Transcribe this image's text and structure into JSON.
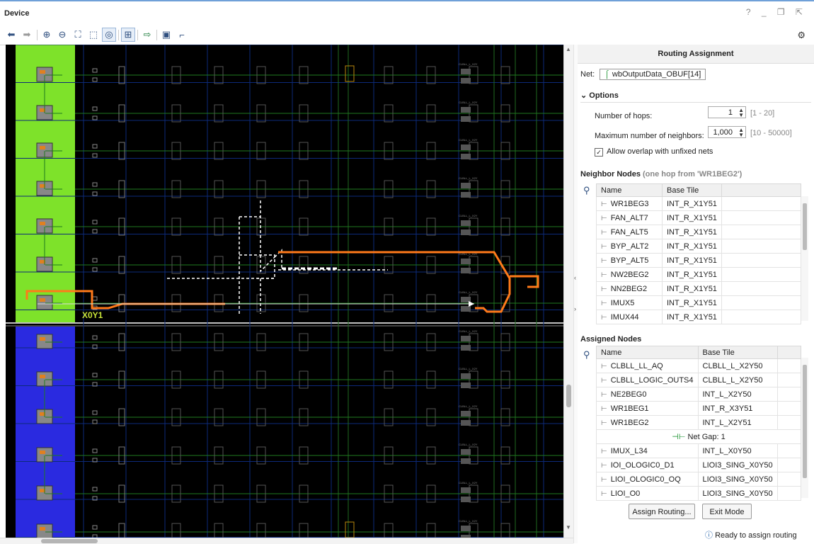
{
  "window": {
    "title": "Device",
    "controls": "? _ ❐ ⇱ ⇲"
  },
  "toolbar": {
    "icons": [
      "back-arrow-icon",
      "forward-arrow-icon",
      "zoom-in-icon",
      "zoom-out-icon",
      "zoom-fit-icon",
      "zoom-area-icon",
      "auto-fit-selection-icon",
      "routing-resources-icon",
      "add-pblock-icon",
      "show-ios-icon",
      "extra-icon"
    ],
    "settings_icon": "gear-icon"
  },
  "device_view": {
    "region_label": "X0Y1",
    "tile_label": "CLBLL_L_X2Y",
    "colors": {
      "clock_region_top": "#7ee22a",
      "clock_region_bottom": "#2a2ae0",
      "route": "#ff7a1a",
      "wire": "#1f7a1f"
    }
  },
  "routing_panel": {
    "title": "Routing Assignment",
    "net_label": "Net:",
    "net_name": "wbOutputData_OBUF[14]",
    "options_label": "Options",
    "hops_label": "Number of hops:",
    "hops_value": "1",
    "hops_range": "[1 - 20]",
    "neighbors_label": "Maximum number of neighbors:",
    "neighbors_value": "1,000",
    "neighbors_range": "[10 - 50000]",
    "overlap_label": "Allow overlap with unfixed nets",
    "overlap_checked": true,
    "neighbor_nodes_title": "Neighbor Nodes",
    "neighbor_nodes_sub": "(one hop from 'WR1BEG2')",
    "neighbor_columns": [
      "Name",
      "Base Tile"
    ],
    "neighbor_rows": [
      [
        "WR1BEG3",
        "INT_R_X1Y51"
      ],
      [
        "FAN_ALT7",
        "INT_R_X1Y51"
      ],
      [
        "FAN_ALT5",
        "INT_R_X1Y51"
      ],
      [
        "BYP_ALT2",
        "INT_R_X1Y51"
      ],
      [
        "BYP_ALT5",
        "INT_R_X1Y51"
      ],
      [
        "NW2BEG2",
        "INT_R_X1Y51"
      ],
      [
        "NN2BEG2",
        "INT_R_X1Y51"
      ],
      [
        "IMUX5",
        "INT_R_X1Y51"
      ],
      [
        "IMUX44",
        "INT_R_X1Y51"
      ]
    ],
    "assigned_nodes_title": "Assigned Nodes",
    "assigned_columns": [
      "Name",
      "Base Tile"
    ],
    "assigned_rows": [
      [
        "CLBLL_LL_AQ",
        "CLBLL_L_X2Y50"
      ],
      [
        "CLBLL_LOGIC_OUTS4",
        "CLBLL_L_X2Y50"
      ],
      [
        "NE2BEG0",
        "INT_L_X2Y50"
      ],
      [
        "WR1BEG1",
        "INT_R_X3Y51"
      ],
      [
        "WR1BEG2",
        "INT_L_X2Y51"
      ]
    ],
    "gap_label": "Net Gap: 1",
    "assigned_rows_after": [
      [
        "IMUX_L34",
        "INT_L_X0Y50"
      ],
      [
        "IOI_OLOGIC0_D1",
        "LIOI3_SING_X0Y50"
      ],
      [
        "LIOI_OLOGIC0_OQ",
        "LIOI3_SING_X0Y50"
      ],
      [
        "LIOI_O0",
        "LIOI3_SING_X0Y50"
      ]
    ],
    "assign_button": "Assign Routing...",
    "exit_button": "Exit Mode",
    "status_text": "Ready to assign routing"
  }
}
